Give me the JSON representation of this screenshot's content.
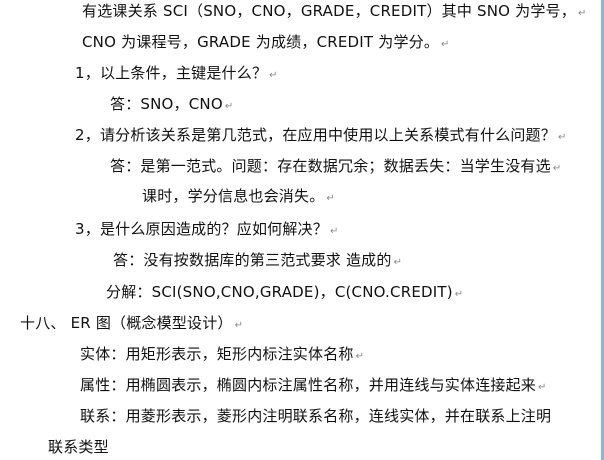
{
  "doc": {
    "lines": {
      "l1": "有选课关系 SCI（SNO，CNO，GRADE，CREDIT）其中 SNO 为学号，",
      "l2": "CNO 为课程号，GRADE 为成绩，CREDIT 为学分。",
      "l3": "1，以上条件，主键是什么？",
      "l4": "答：SNO，CNO",
      "l5": "2，请分析该关系是第几范式，在应用中使用以上关系模式有什么问题？",
      "l6": "答：是第一范式。问题：存在数据冗余；数据丢失：当学生没有选",
      "l7": "课时，学分信息也会消失。",
      "l8": "3，是什么原因造成的？应如何解决？",
      "l9": "答：没有按数据库的第三范式要求 造成的",
      "l10": "分解：SCI(SNO,CNO,GRADE)，C(CNO.CREDIT)",
      "l11": "十八、  ER 图（概念模型设计）",
      "l12": "实体：用矩形表示，矩形内标注实体名称",
      "l13": "属性：用椭圆表示，椭圆内标注属性名称，并用连线与实体连接起来",
      "l14": "联系：用菱形表示，菱形内注明联系名称，连线实体，并在联系上注明",
      "l15": "联系类型"
    },
    "paragraph_mark": "↵"
  }
}
